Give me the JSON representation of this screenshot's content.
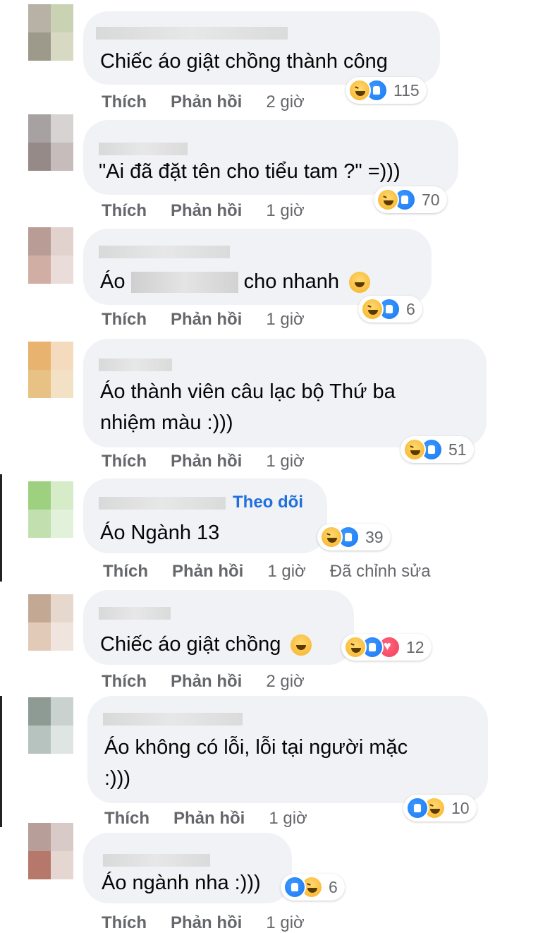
{
  "actions": {
    "like": "Thích",
    "reply": "Phản hồi"
  },
  "colors": {
    "bubble": "#f0f2f5",
    "link": "#216fdb",
    "muted": "#65676b",
    "haha": "#f7b125",
    "like": "#1877f2",
    "love": "#f33e58"
  },
  "comments": [
    {
      "text": "Chiếc áo giật chồng thành công",
      "time": "2 giờ",
      "count": "115",
      "reactions": [
        "haha-icon",
        "like-icon"
      ]
    },
    {
      "text": "\"Ai đã đặt tên cho tiểu tam ?\" =)))",
      "time": "1 giờ",
      "count": "70",
      "reactions": [
        "haha-icon",
        "like-icon"
      ]
    },
    {
      "text_prefix": "Áo",
      "text_suffix": "cho nhanh",
      "time": "1 giờ",
      "count": "6",
      "reactions": [
        "haha-icon",
        "like-icon"
      ]
    },
    {
      "text_line1": "Áo thành viên câu lạc bộ Thứ ba",
      "text_line2": "nhiệm màu :)))",
      "time": "1 giờ",
      "count": "51",
      "reactions": [
        "haha-icon",
        "like-icon"
      ]
    },
    {
      "follow": "Theo dõi",
      "text": "Áo Ngành 13",
      "time": "1 giờ",
      "edited": "Đã chỉnh sửa",
      "count": "39",
      "reactions": [
        "haha-icon",
        "like-icon"
      ]
    },
    {
      "text": "Chiếc áo giật chồng",
      "time": "2 giờ",
      "count": "12",
      "reactions": [
        "haha-icon",
        "like-icon",
        "love-icon"
      ]
    },
    {
      "text_line1": "Áo không có lỗi, lỗi tại người mặc",
      "text_line2": ":)))",
      "time": "1 giờ",
      "count": "10",
      "reactions": [
        "like-icon",
        "haha-icon"
      ]
    },
    {
      "text": "Áo ngành nha :)))",
      "time": "1 giờ",
      "count": "6",
      "reactions": [
        "like-icon",
        "haha-icon"
      ]
    }
  ]
}
